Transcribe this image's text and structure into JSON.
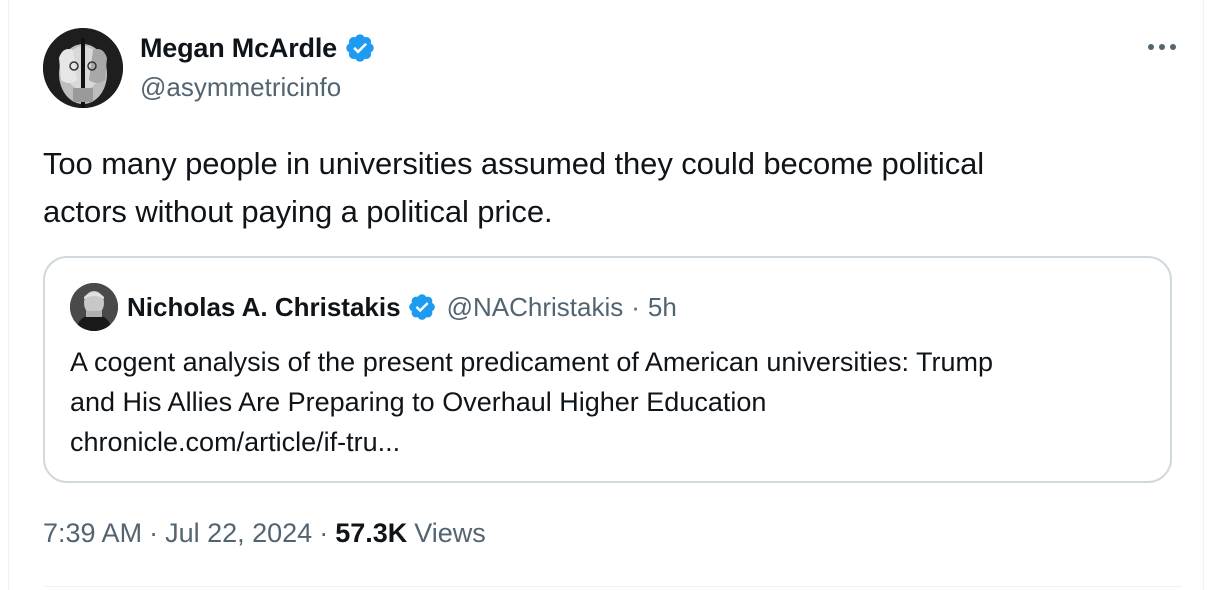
{
  "author": {
    "display_name": "Megan McArdle",
    "handle": "@asymmetricinfo",
    "verified": true,
    "avatar_icon": "avatar-hands-over-face"
  },
  "menu": {
    "icon": "more-icon"
  },
  "tweet": {
    "text_line_1": "Too many people in universities assumed they could become political",
    "text_line_2": "actors without paying a political price."
  },
  "quoted": {
    "display_name": "Nicholas A. Christakis",
    "handle": "@NAChristakis",
    "separator": "·",
    "time_ago": "5h",
    "verified": true,
    "body_line_1": "A cogent analysis of the present predicament of American universities: Trump",
    "body_line_2": "and His Allies Are Preparing to Overhaul Higher Education",
    "body_line_3": "chronicle.com/article/if-tru..."
  },
  "meta": {
    "time": "7:39 AM",
    "sep1": "·",
    "date": "Jul 22, 2024",
    "sep2": "·",
    "views_count": "57.3K",
    "views_label": "Views"
  },
  "colors": {
    "verified_blue": "#1d9bf0",
    "secondary_text": "#536471",
    "primary_text": "#0f1419",
    "border": "#cfd9de"
  }
}
